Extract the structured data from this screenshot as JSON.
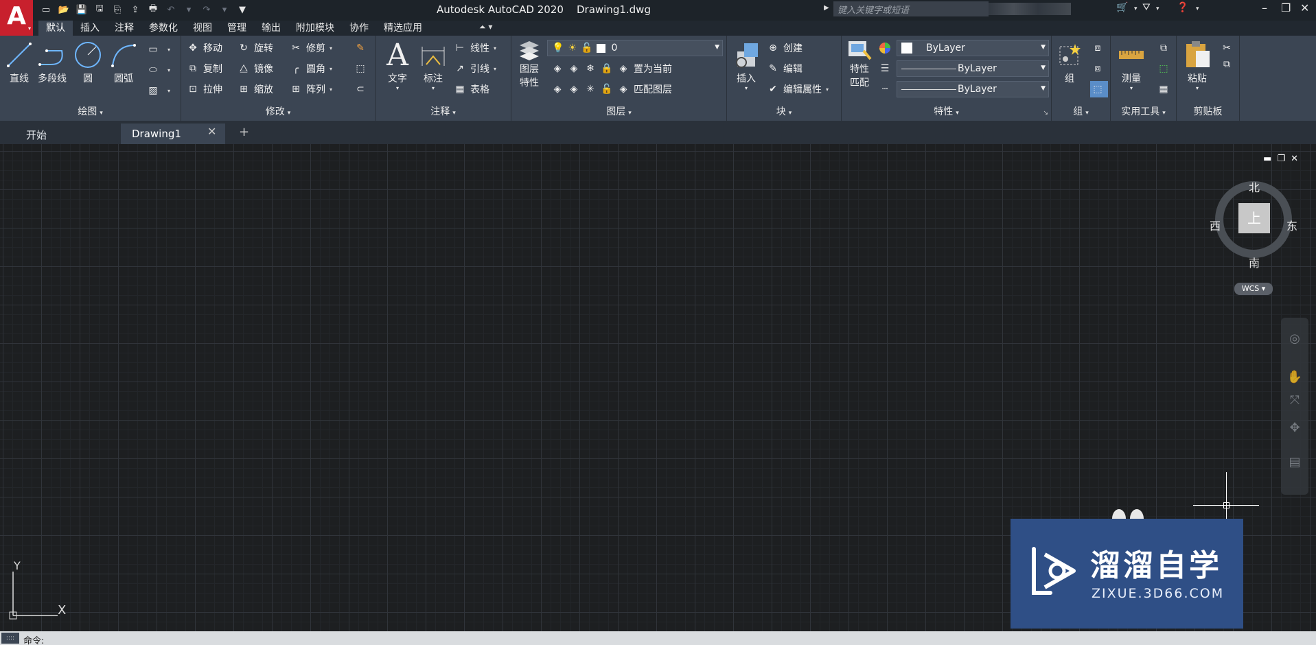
{
  "window": {
    "title": "Autodesk AutoCAD 2020    Drawing1.dwg"
  },
  "app_menu": {
    "letter": "A"
  },
  "search": {
    "placeholder": "键入关键字或短语"
  },
  "menu_tabs": [
    "默认",
    "插入",
    "注释",
    "参数化",
    "视图",
    "管理",
    "输出",
    "附加模块",
    "协作",
    "精选应用"
  ],
  "ribbon": {
    "draw": {
      "title": "绘图",
      "line": "直线",
      "polyline": "多段线",
      "circle": "圆",
      "arc": "圆弧"
    },
    "modify": {
      "title": "修改",
      "move": "移动",
      "rotate": "旋转",
      "trim": "修剪",
      "copy": "复制",
      "mirror": "镜像",
      "fillet": "圆角",
      "stretch": "拉伸",
      "scale": "缩放",
      "array": "阵列"
    },
    "annotation": {
      "title": "注释",
      "text": "文字",
      "dimension": "标注",
      "linear": "线性",
      "leader": "引线",
      "table": "表格"
    },
    "layers": {
      "title": "图层",
      "properties_l1": "图层",
      "properties_l2": "特性",
      "current_layer": "0",
      "set_current": "置为当前",
      "match_layer": "匹配图层"
    },
    "block": {
      "title": "块",
      "insert": "插入",
      "create": "创建",
      "edit": "编辑",
      "edit_attributes": "编辑属性"
    },
    "properties": {
      "title": "特性",
      "match_l1": "特性",
      "match_l2": "匹配",
      "color": "ByLayer",
      "linetype": "ByLayer",
      "lineweight": "ByLayer"
    },
    "groups": {
      "title": "组",
      "group": "组"
    },
    "utilities": {
      "title": "实用工具",
      "measure": "测量"
    },
    "clipboard": {
      "title": "剪贴板",
      "paste": "粘贴"
    }
  },
  "file_tabs": [
    {
      "label": "开始",
      "active": false
    },
    {
      "label": "Drawing1",
      "active": true
    }
  ],
  "viewcube": {
    "north": "北",
    "south": "南",
    "east": "东",
    "west": "西",
    "face": "上",
    "wcs": "WCS"
  },
  "ucs": {
    "x": "X",
    "y": "Y"
  },
  "watermark": {
    "title": "溜溜自学",
    "subtitle": "ZIXUE.3D66.COM"
  },
  "command": {
    "prompt": "命令:"
  },
  "colors": {
    "app_red": "#c8202d",
    "ribbon_bg": "#3b4553",
    "canvas_bg": "#1d1f21",
    "watermark_bg": "#2f4f86"
  }
}
